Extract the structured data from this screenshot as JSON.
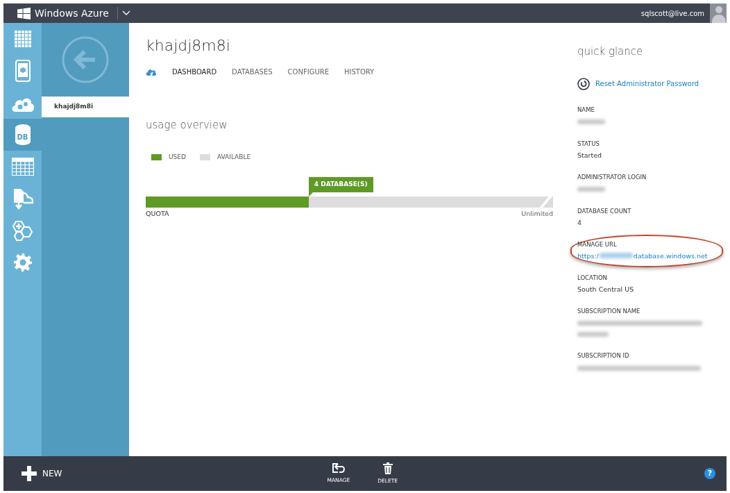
{
  "topbar": {
    "brand": "Windows Azure",
    "user": "sqlscott@live.com"
  },
  "rail": [
    {
      "kind": "grid",
      "selected": false
    },
    {
      "kind": "mobile",
      "selected": false
    },
    {
      "kind": "cloud",
      "selected": false
    },
    {
      "kind": "db",
      "label": "DB",
      "selected": true
    },
    {
      "kind": "table",
      "selected": false
    },
    {
      "kind": "import",
      "selected": false
    },
    {
      "kind": "hex",
      "selected": false
    },
    {
      "kind": "gear",
      "selected": false
    }
  ],
  "subnav": {
    "items": [
      {
        "label": "khajdj8m8i",
        "selected": true
      }
    ]
  },
  "page": {
    "title": "khajdj8m8i",
    "tabs": [
      {
        "label": "DASHBOARD",
        "selected": true
      },
      {
        "label": "DATABASES",
        "selected": false
      },
      {
        "label": "CONFIGURE",
        "selected": false
      },
      {
        "label": "HISTORY",
        "selected": false
      }
    ]
  },
  "usage": {
    "title": "usage overview",
    "legend": [
      {
        "label": "USED",
        "color": "#5f9a26"
      },
      {
        "label": "AVAILABLE",
        "color": "#dddddd"
      }
    ],
    "callout": "4 DATABASE(S)",
    "level": 0.4,
    "left_label": "QUOTA",
    "right_label": "Unlimited"
  },
  "glance": {
    "title": "quick glance",
    "action": "Reset Administrator Password",
    "fields": [
      {
        "label": "NAME",
        "kind": "blurred"
      },
      {
        "label": "STATUS",
        "kind": "text",
        "value": "Started"
      },
      {
        "label": "ADMINISTRATOR LOGIN",
        "kind": "blurred"
      },
      {
        "label": "DATABASE COUNT",
        "kind": "text",
        "value": "4"
      },
      {
        "label": "MANAGE URL",
        "kind": "link",
        "prefix": "https:/",
        "suffix": "database.windows.net",
        "highlighted": true
      },
      {
        "label": "LOCATION",
        "kind": "text",
        "value": "South Central US"
      },
      {
        "label": "SUBSCRIPTION NAME",
        "kind": "blurred",
        "wrapped": true
      },
      {
        "label": "SUBSCRIPTION ID",
        "kind": "blurred"
      }
    ]
  },
  "bottombar": {
    "new": "NEW",
    "actions": [
      {
        "kind": "manage",
        "label": "MANAGE"
      },
      {
        "kind": "delete",
        "label": "DELETE"
      }
    ],
    "help": "?"
  }
}
